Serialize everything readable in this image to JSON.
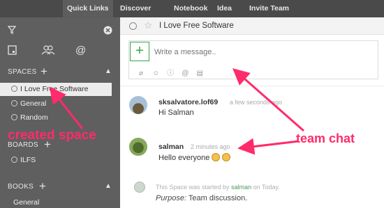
{
  "topnav": {
    "tabs": [
      "Quick Links",
      "Discover",
      "Notebook",
      "Idea",
      "Invite Team"
    ],
    "active": "Quick Links"
  },
  "sidebar": {
    "icons": [
      "filter-icon",
      "close-icon",
      "bookmark-icon",
      "team-icon",
      "mention-icon"
    ],
    "spaces_label": "SPACES",
    "spaces": [
      "I Love Free Software",
      "General",
      "Random"
    ],
    "active_space": "I Love Free Software",
    "boards_label": "BOARDS",
    "boards": [
      "ILFS"
    ],
    "books_label": "BOOKS",
    "books": [
      "General"
    ]
  },
  "header": {
    "space_title": "I Love Free Software"
  },
  "composer": {
    "placeholder": "Write a message..",
    "tools": [
      "attach-icon",
      "emoji-icon",
      "info-icon",
      "mention-icon",
      "format-icon"
    ]
  },
  "messages": [
    {
      "author": "sksalvatore.lof69",
      "time": "a few seconds ago",
      "text": "Hi Salman"
    },
    {
      "author": "salman",
      "time": "2 minutes ago",
      "text": "Hello everyone"
    }
  ],
  "system": {
    "prefix": "This Space was started by",
    "who": "salman",
    "suffix": "on Today.",
    "purpose_label": "Purpose:",
    "purpose_value": "Team discussion."
  },
  "annotations": {
    "created_space": "created space",
    "team_chat": "team chat",
    "color": "#ff2b6a"
  },
  "colors": {
    "topbar": "#4a4a4a",
    "sidebar": "#5f5f5f",
    "accent_green": "#3aa24b"
  }
}
